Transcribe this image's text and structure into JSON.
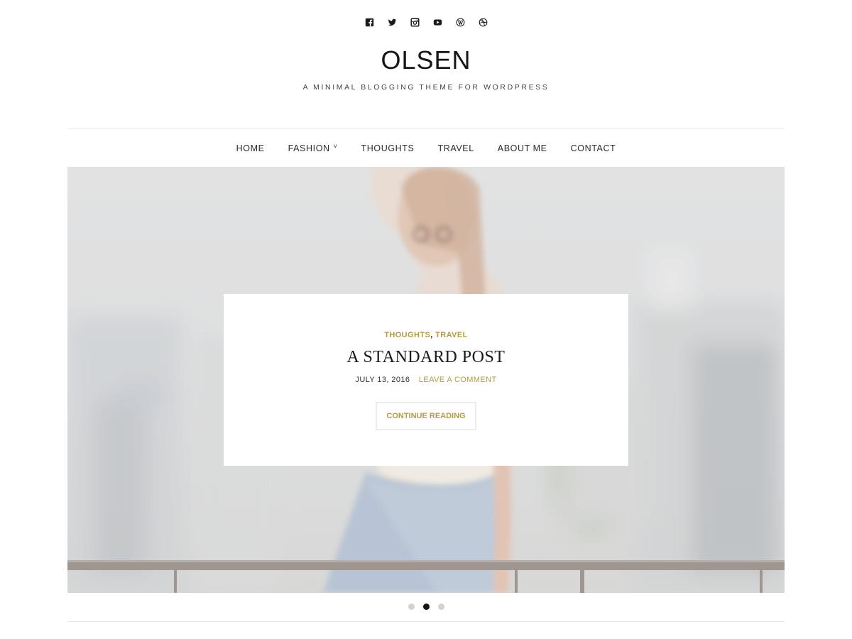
{
  "social": [
    {
      "name": "facebook-icon",
      "label": "Facebook"
    },
    {
      "name": "twitter-icon",
      "label": "Twitter"
    },
    {
      "name": "instagram-icon",
      "label": "Instagram"
    },
    {
      "name": "youtube-icon",
      "label": "YouTube"
    },
    {
      "name": "wordpress-icon",
      "label": "WordPress"
    },
    {
      "name": "dribbble-icon",
      "label": "Dribbble"
    }
  ],
  "site": {
    "title": "OLSEN",
    "tagline": "A MINIMAL BLOGGING THEME FOR WORDPRESS"
  },
  "nav": {
    "items": [
      {
        "label": "HOME"
      },
      {
        "label": "FASHION",
        "has_submenu": true
      },
      {
        "label": "THOUGHTS"
      },
      {
        "label": "TRAVEL"
      },
      {
        "label": "ABOUT ME"
      },
      {
        "label": "CONTACT"
      }
    ],
    "submenu_indicator": "˅"
  },
  "slide": {
    "categories": [
      "THOUGHTS",
      "TRAVEL"
    ],
    "category_separator": ",",
    "title": "A STANDARD POST",
    "date": "JULY 13, 2016",
    "comments_link": "LEAVE A COMMENT",
    "button_label": "CONTINUE READING",
    "image_description": "woman with sunglasses sitting on a railing, city background"
  },
  "slider": {
    "total_slides": 3,
    "active_index": 1
  },
  "colors": {
    "accent": "#b59a45",
    "text": "#1a1a1a",
    "dot_inactive": "#d2d2d2",
    "dot_active": "#151515"
  }
}
